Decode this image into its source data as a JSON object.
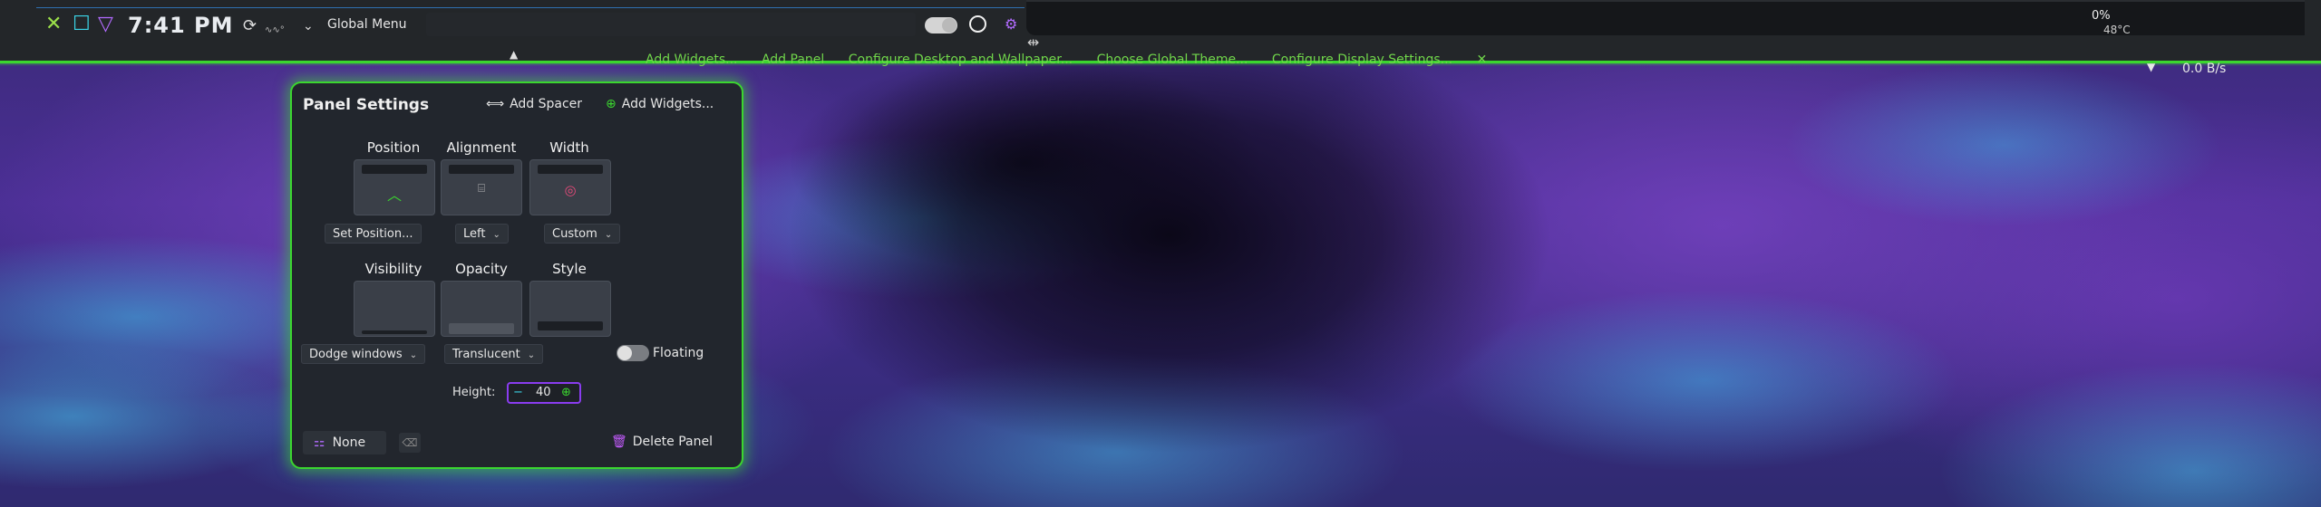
{
  "topbar": {
    "clock": "7:41 PM",
    "global_menu": "Global Menu",
    "battery": "0%",
    "temperature": "48°C",
    "network_speed": "0.0 B/s"
  },
  "edit_toolbar": {
    "add_widgets": "Add Widgets...",
    "add_panel": "Add Panel",
    "configure_desktop": "Configure Desktop and Wallpaper...",
    "global_theme": "Choose Global Theme...",
    "display_settings": "Configure Display Settings..."
  },
  "dialog": {
    "title": "Panel Settings",
    "add_spacer": "Add Spacer",
    "add_widgets": "Add Widgets...",
    "position": {
      "label": "Position",
      "value": "Set Position..."
    },
    "alignment": {
      "label": "Alignment",
      "value": "Left"
    },
    "width": {
      "label": "Width",
      "value": "Custom"
    },
    "visibility": {
      "label": "Visibility",
      "value": "Dodge windows"
    },
    "opacity": {
      "label": "Opacity",
      "value": "Translucent"
    },
    "style": {
      "label": "Style",
      "value": "Floating"
    },
    "height": {
      "label": "Height:",
      "value": "40"
    },
    "none_button": "None",
    "delete_panel": "Delete Panel"
  },
  "colors": {
    "accent_green": "#3bd62f",
    "accent_purple": "#b26bff",
    "accent_cyan": "#3bd6e8"
  }
}
